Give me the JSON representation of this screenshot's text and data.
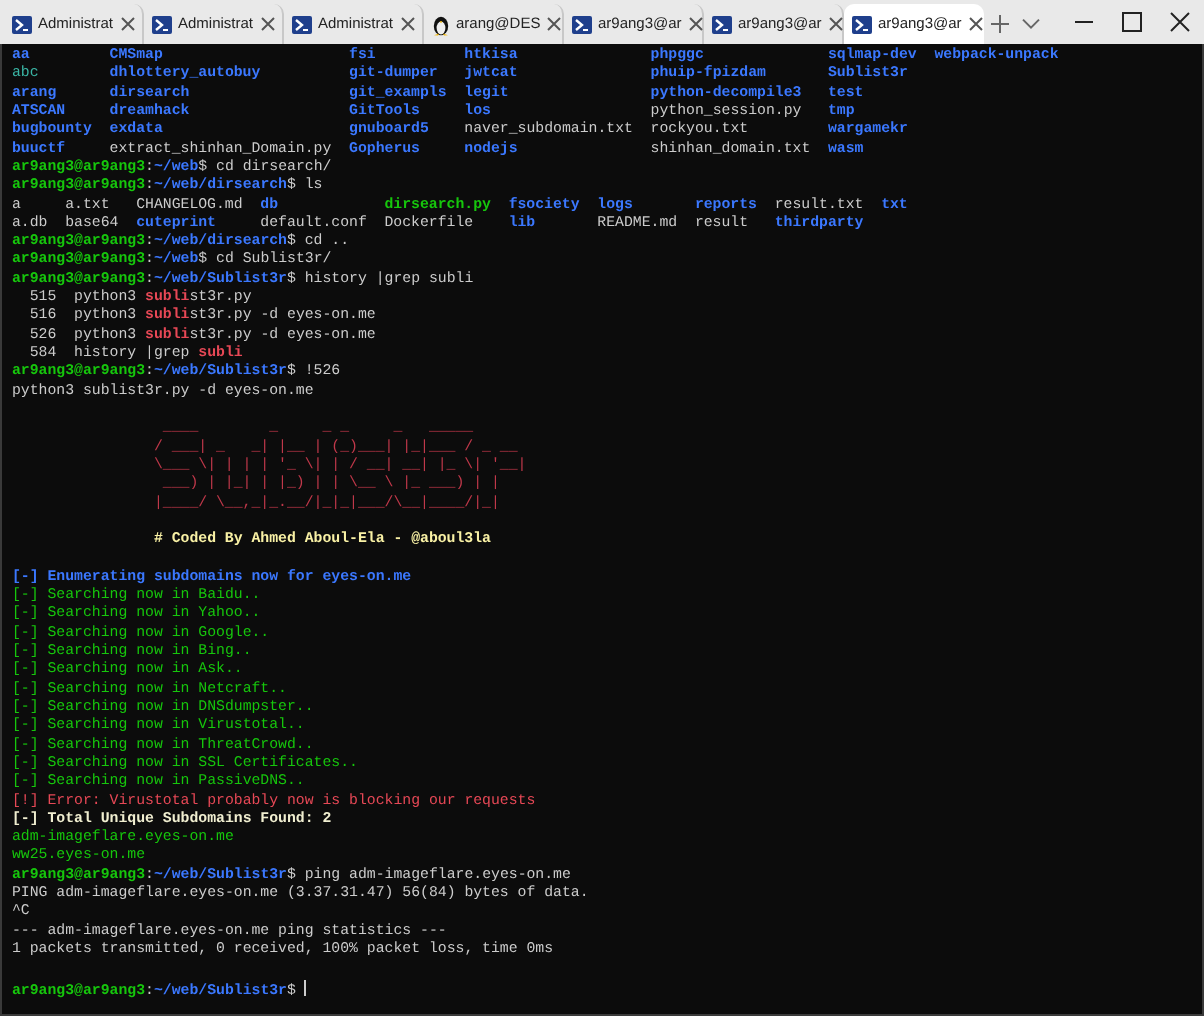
{
  "tabs": [
    {
      "title": "Administrat",
      "kind": "shell",
      "selected": false
    },
    {
      "title": "Administrat",
      "kind": "shell",
      "selected": false
    },
    {
      "title": "Administrat",
      "kind": "shell",
      "selected": false
    },
    {
      "title": "arang@DES",
      "kind": "linux",
      "selected": false
    },
    {
      "title": "ar9ang3@ar",
      "kind": "shell",
      "selected": false
    },
    {
      "title": "ar9ang3@ar",
      "kind": "shell",
      "selected": false
    },
    {
      "title": "ar9ang3@ar",
      "kind": "shell",
      "selected": true
    }
  ],
  "terminal": {
    "lines": [
      {
        "kind": "ls",
        "columns": [
          [
            {
              "text": "aa",
              "kind": "dir"
            },
            {
              "text": "abc",
              "kind": "shared"
            },
            {
              "text": "arang",
              "kind": "dir"
            },
            {
              "text": "ATSCAN",
              "kind": "dir"
            },
            {
              "text": "bugbounty",
              "kind": "dir"
            },
            {
              "text": "buuctf",
              "kind": "dir"
            }
          ],
          [
            {
              "text": "CMSmap",
              "kind": "dir"
            },
            {
              "text": "dhlottery_autobuy",
              "kind": "dir"
            },
            {
              "text": "dirsearch",
              "kind": "dir"
            },
            {
              "text": "dreamhack",
              "kind": "dir"
            },
            {
              "text": "exdata",
              "kind": "dir"
            },
            {
              "text": "extract_shinhan_Domain.py",
              "kind": "file"
            }
          ],
          [
            {
              "text": "fsi",
              "kind": "dir"
            },
            {
              "text": "git-dumper",
              "kind": "dir"
            },
            {
              "text": "git_exampls",
              "kind": "dir"
            },
            {
              "text": "GitTools",
              "kind": "dir"
            },
            {
              "text": "gnuboard5",
              "kind": "dir"
            },
            {
              "text": "Gopherus",
              "kind": "dir"
            }
          ],
          [
            {
              "text": "htkisa",
              "kind": "dir"
            },
            {
              "text": "jwtcat",
              "kind": "dir"
            },
            {
              "text": "legit",
              "kind": "dir"
            },
            {
              "text": "los",
              "kind": "dir"
            },
            {
              "text": "naver_subdomain.txt",
              "kind": "file"
            },
            {
              "text": "nodejs",
              "kind": "dir"
            }
          ],
          [
            {
              "text": "phpggc",
              "kind": "dir"
            },
            {
              "text": "phuip-fpizdam",
              "kind": "dir"
            },
            {
              "text": "python-decompile3",
              "kind": "dir"
            },
            {
              "text": "python_session.py",
              "kind": "file"
            },
            {
              "text": "rockyou.txt",
              "kind": "file"
            },
            {
              "text": "shinhan_domain.txt",
              "kind": "file"
            }
          ],
          [
            {
              "text": "sqlmap-dev",
              "kind": "dir"
            },
            {
              "text": "Sublist3r",
              "kind": "dir"
            },
            {
              "text": "test",
              "kind": "dir"
            },
            {
              "text": "tmp",
              "kind": "dir"
            },
            {
              "text": "wargamekr",
              "kind": "dir"
            },
            {
              "text": "wasm",
              "kind": "dir"
            }
          ],
          [
            {
              "text": "webpack-unpack",
              "kind": "dir"
            }
          ]
        ]
      },
      {
        "kind": "text",
        "segments": [
          {
            "text": "ar9ang3@ar9ang3",
            "kind": "user"
          },
          {
            "text": ":",
            "kind": "plain"
          },
          {
            "text": "~/web",
            "kind": "path"
          },
          {
            "text": "$ cd dirsearch/",
            "kind": "plain"
          }
        ]
      },
      {
        "kind": "text",
        "segments": [
          {
            "text": "ar9ang3@ar9ang3",
            "kind": "user"
          },
          {
            "text": ":",
            "kind": "plain"
          },
          {
            "text": "~/web/dirsearch",
            "kind": "path"
          },
          {
            "text": "$ ls",
            "kind": "plain"
          }
        ]
      },
      {
        "kind": "ls",
        "columns": [
          [
            {
              "text": "a",
              "kind": "file"
            },
            {
              "text": "a.db",
              "kind": "file"
            }
          ],
          [
            {
              "text": "a.txt",
              "kind": "file"
            },
            {
              "text": "base64",
              "kind": "file"
            }
          ],
          [
            {
              "text": "CHANGELOG.md",
              "kind": "file"
            },
            {
              "text": "cuteprint",
              "kind": "dir"
            }
          ],
          [
            {
              "text": "db",
              "kind": "dir"
            },
            {
              "text": "default.conf",
              "kind": "file"
            }
          ],
          [
            {
              "text": "dirsearch.py",
              "kind": "exec"
            },
            {
              "text": "Dockerfile",
              "kind": "file"
            }
          ],
          [
            {
              "text": "fsociety",
              "kind": "dir"
            },
            {
              "text": "lib",
              "kind": "dir"
            }
          ],
          [
            {
              "text": "logs",
              "kind": "dir"
            },
            {
              "text": "README.md",
              "kind": "file"
            }
          ],
          [
            {
              "text": "reports",
              "kind": "dir"
            },
            {
              "text": "result",
              "kind": "file"
            }
          ],
          [
            {
              "text": "result.txt",
              "kind": "file"
            },
            {
              "text": "thirdparty",
              "kind": "dir"
            }
          ],
          [
            {
              "text": "txt",
              "kind": "dir"
            }
          ]
        ]
      },
      {
        "kind": "text",
        "segments": [
          {
            "text": "ar9ang3@ar9ang3",
            "kind": "user"
          },
          {
            "text": ":",
            "kind": "plain"
          },
          {
            "text": "~/web/dirsearch",
            "kind": "path"
          },
          {
            "text": "$ cd ..",
            "kind": "plain"
          }
        ]
      },
      {
        "kind": "text",
        "segments": [
          {
            "text": "ar9ang3@ar9ang3",
            "kind": "user"
          },
          {
            "text": ":",
            "kind": "plain"
          },
          {
            "text": "~/web",
            "kind": "path"
          },
          {
            "text": "$ cd Sublist3r/",
            "kind": "plain"
          }
        ]
      },
      {
        "kind": "text",
        "segments": [
          {
            "text": "ar9ang3@ar9ang3",
            "kind": "user"
          },
          {
            "text": ":",
            "kind": "plain"
          },
          {
            "text": "~/web/Sublist3r",
            "kind": "path"
          },
          {
            "text": "$ history |grep subli",
            "kind": "plain"
          }
        ]
      },
      {
        "kind": "text",
        "segments": [
          {
            "text": "  515  python3 ",
            "kind": "plain"
          },
          {
            "text": "subli",
            "kind": "match"
          },
          {
            "text": "st3r.py",
            "kind": "plain"
          }
        ]
      },
      {
        "kind": "text",
        "segments": [
          {
            "text": "  516  python3 ",
            "kind": "plain"
          },
          {
            "text": "subli",
            "kind": "match"
          },
          {
            "text": "st3r.py -d eyes-on.me",
            "kind": "plain"
          }
        ]
      },
      {
        "kind": "text",
        "segments": [
          {
            "text": "  526  python3 ",
            "kind": "plain"
          },
          {
            "text": "subli",
            "kind": "match"
          },
          {
            "text": "st3r.py -d eyes-on.me",
            "kind": "plain"
          }
        ]
      },
      {
        "kind": "text",
        "segments": [
          {
            "text": "  584  history |grep ",
            "kind": "plain"
          },
          {
            "text": "subli",
            "kind": "match"
          }
        ]
      },
      {
        "kind": "text",
        "segments": [
          {
            "text": "ar9ang3@ar9ang3",
            "kind": "user"
          },
          {
            "text": ":",
            "kind": "plain"
          },
          {
            "text": "~/web/Sublist3r",
            "kind": "path"
          },
          {
            "text": "$ !526",
            "kind": "plain"
          }
        ]
      },
      {
        "kind": "text",
        "segments": [
          {
            "text": "python3 sublist3r.py -d eyes-on.me",
            "kind": "plain"
          }
        ]
      },
      {
        "kind": "blank"
      },
      {
        "kind": "banner",
        "art": [
          " ____        _     _ _     _   _____",
          "/ ___| _   _| |__ | (_)___| |_|___ / _ __",
          "\\___ \\| | | | '_ \\| | / __| __| |_ \\| '__|",
          " ___) | |_| | |_) | | \\__ \\ |_ ___) | |",
          "|____/ \\__,_|_.__/|_|_|___/\\__|____/|_|"
        ]
      },
      {
        "kind": "blank"
      },
      {
        "kind": "text",
        "indent": true,
        "segments": [
          {
            "text": "# Coded By Ahmed Aboul-Ela - @aboul3la",
            "kind": "credit"
          }
        ]
      },
      {
        "kind": "blank"
      },
      {
        "kind": "text",
        "segments": [
          {
            "text": "[-] Enumerating subdomains now for eyes-on.me",
            "kind": "info"
          }
        ]
      },
      {
        "kind": "text",
        "segments": [
          {
            "text": "[-] Searching now in Baidu..",
            "kind": "success"
          }
        ]
      },
      {
        "kind": "text",
        "segments": [
          {
            "text": "[-] Searching now in Yahoo..",
            "kind": "success"
          }
        ]
      },
      {
        "kind": "text",
        "segments": [
          {
            "text": "[-] Searching now in Google..",
            "kind": "success"
          }
        ]
      },
      {
        "kind": "text",
        "segments": [
          {
            "text": "[-] Searching now in Bing..",
            "kind": "success"
          }
        ]
      },
      {
        "kind": "text",
        "segments": [
          {
            "text": "[-] Searching now in Ask..",
            "kind": "success"
          }
        ]
      },
      {
        "kind": "text",
        "segments": [
          {
            "text": "[-] Searching now in Netcraft..",
            "kind": "success"
          }
        ]
      },
      {
        "kind": "text",
        "segments": [
          {
            "text": "[-] Searching now in DNSdumpster..",
            "kind": "success"
          }
        ]
      },
      {
        "kind": "text",
        "segments": [
          {
            "text": "[-] Searching now in Virustotal..",
            "kind": "success"
          }
        ]
      },
      {
        "kind": "text",
        "segments": [
          {
            "text": "[-] Searching now in ThreatCrowd..",
            "kind": "success"
          }
        ]
      },
      {
        "kind": "text",
        "segments": [
          {
            "text": "[-] Searching now in SSL Certificates..",
            "kind": "success"
          }
        ]
      },
      {
        "kind": "text",
        "segments": [
          {
            "text": "[-] Searching now in PassiveDNS..",
            "kind": "success"
          }
        ]
      },
      {
        "kind": "text",
        "segments": [
          {
            "text": "[!] Error: Virustotal probably now is blocking our requests",
            "kind": "error"
          }
        ]
      },
      {
        "kind": "text",
        "segments": [
          {
            "text": "[-] Total Unique Subdomains Found: 2",
            "kind": "total"
          }
        ]
      },
      {
        "kind": "text",
        "segments": [
          {
            "text": "adm-imageflare.eyes-on.me",
            "kind": "success"
          }
        ]
      },
      {
        "kind": "text",
        "segments": [
          {
            "text": "ww25.eyes-on.me",
            "kind": "success"
          }
        ]
      },
      {
        "kind": "text",
        "segments": [
          {
            "text": "ar9ang3@ar9ang3",
            "kind": "user"
          },
          {
            "text": ":",
            "kind": "plain"
          },
          {
            "text": "~/web/Sublist3r",
            "kind": "path"
          },
          {
            "text": "$ ping adm-imageflare.eyes-on.me",
            "kind": "plain"
          }
        ]
      },
      {
        "kind": "text",
        "segments": [
          {
            "text": "PING adm-imageflare.eyes-on.me (3.37.31.47) 56(84) bytes of data.",
            "kind": "plain"
          }
        ]
      },
      {
        "kind": "text",
        "segments": [
          {
            "text": "^C",
            "kind": "plain"
          }
        ]
      },
      {
        "kind": "text",
        "segments": [
          {
            "text": "--- adm-imageflare.eyes-on.me ping statistics ---",
            "kind": "plain"
          }
        ]
      },
      {
        "kind": "text",
        "segments": [
          {
            "text": "1 packets transmitted, 0 received, 100% packet loss, time 0ms",
            "kind": "plain"
          }
        ]
      },
      {
        "kind": "blank"
      },
      {
        "kind": "text",
        "cursor": true,
        "segments": [
          {
            "text": "ar9ang3@ar9ang3",
            "kind": "user"
          },
          {
            "text": ":",
            "kind": "plain"
          },
          {
            "text": "~/web/Sublist3r",
            "kind": "path"
          },
          {
            "text": "$",
            "kind": "plain"
          }
        ]
      }
    ]
  }
}
